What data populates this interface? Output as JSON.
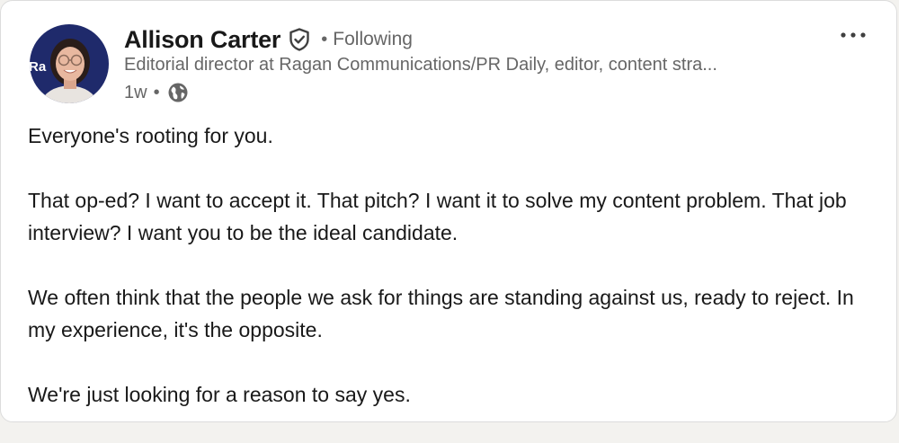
{
  "post": {
    "author": {
      "name": "Allison Carter",
      "follow_status": "Following",
      "headline": "Editorial director at Ragan Communications/PR Daily, editor, content stra...",
      "avatar_backdrop_text": "Ra",
      "verified_icon": "verified-shield-icon"
    },
    "meta": {
      "age": "1w",
      "separator": "•",
      "visibility_icon": "globe-icon"
    },
    "name_separator": "•",
    "more_icon": "ellipsis-icon",
    "paragraphs": [
      "Everyone's rooting for you.",
      "That op-ed? I want to accept it. That pitch? I want it to solve my content problem. That job interview? I want you to be the ideal candidate.",
      "We often think that the people we ask for things are standing against us, ready to reject. In my experience, it's the opposite.",
      "We're just looking for a reason to say yes."
    ]
  },
  "colors": {
    "primary_text": "#191919",
    "secondary_text": "#666666",
    "card_background": "#ffffff",
    "avatar_backdrop": "#1f2a6b"
  }
}
